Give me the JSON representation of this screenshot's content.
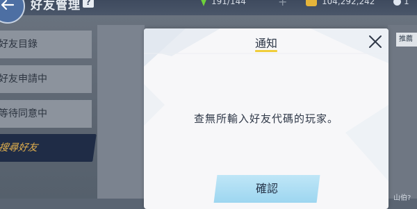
{
  "header": {
    "title": "好友管理",
    "help_label": "?",
    "stamina": "191/144",
    "plus_label": "+",
    "coins": "104,292,242",
    "gems": "1"
  },
  "sidebar": {
    "items": [
      {
        "label": "好友目錄"
      },
      {
        "label": "好友申請中"
      },
      {
        "label": "等待同意中"
      }
    ],
    "active_label": "搜尋好友"
  },
  "right_tab_label": "推薦",
  "corner_text": "山伯?",
  "modal": {
    "title": "通知",
    "message": "查無所輸入好友代碼的玩家。",
    "confirm_label": "確認",
    "close_icon": "close-icon"
  },
  "colors": {
    "accent_yellow": "#f0cd3b",
    "confirm_blue": "#9dd6f0",
    "active_tab_bg": "#1f2c46",
    "active_tab_text": "#e2b04d"
  }
}
